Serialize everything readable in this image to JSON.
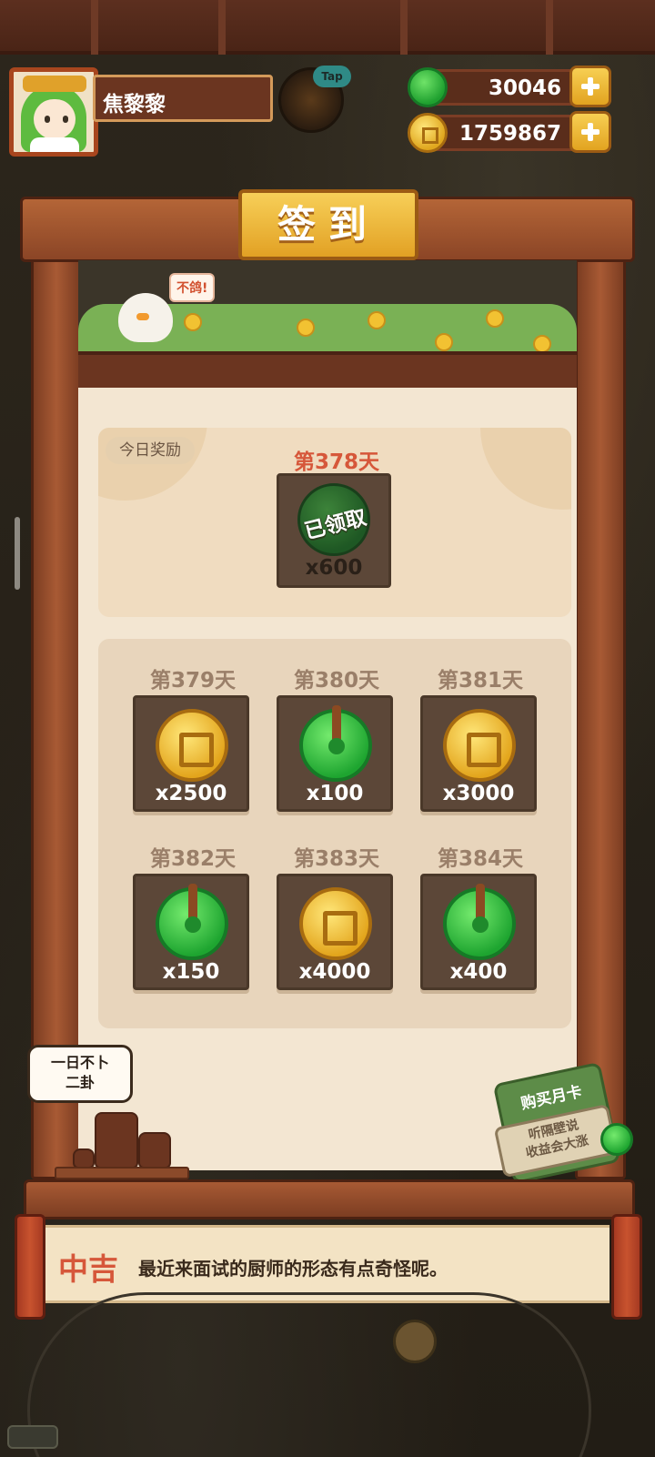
{
  "player": {
    "name": "焦黎黎",
    "tap_badge": "Tap"
  },
  "currencies": {
    "jade": "30046",
    "coins": "1759867"
  },
  "signin": {
    "title": "签到",
    "banner_speech": "不鸽!",
    "today": {
      "tag": "今日奖励",
      "day": "第378天",
      "status": "已领取",
      "amount": "x600",
      "reward": "jade-icon"
    },
    "upcoming": [
      {
        "day": "第379天",
        "reward": "coin-icon",
        "amount": "x2500"
      },
      {
        "day": "第380天",
        "reward": "jade-icon",
        "amount": "x100"
      },
      {
        "day": "第381天",
        "reward": "coin-icon",
        "amount": "x3000"
      },
      {
        "day": "第382天",
        "reward": "jade-icon",
        "amount": "x150"
      },
      {
        "day": "第383天",
        "reward": "coin-icon",
        "amount": "x4000"
      },
      {
        "day": "第384天",
        "reward": "jade-icon",
        "amount": "x400"
      }
    ]
  },
  "speech_bubble": {
    "line1": "一日不卜",
    "line2": "二卦"
  },
  "monthly_card": {
    "title": "购买月卡",
    "line1": "听隔壁说",
    "line2": "收益会大涨"
  },
  "fortune": {
    "level": "中吉",
    "text": "最近来面试的厨师的形态有点奇怪呢。"
  },
  "colors": {
    "wood": "#8b4526",
    "gold": "#f7cf58",
    "jade": "#1fa02f",
    "accent_red": "#d6573a",
    "paper": "#f3e6d2"
  }
}
